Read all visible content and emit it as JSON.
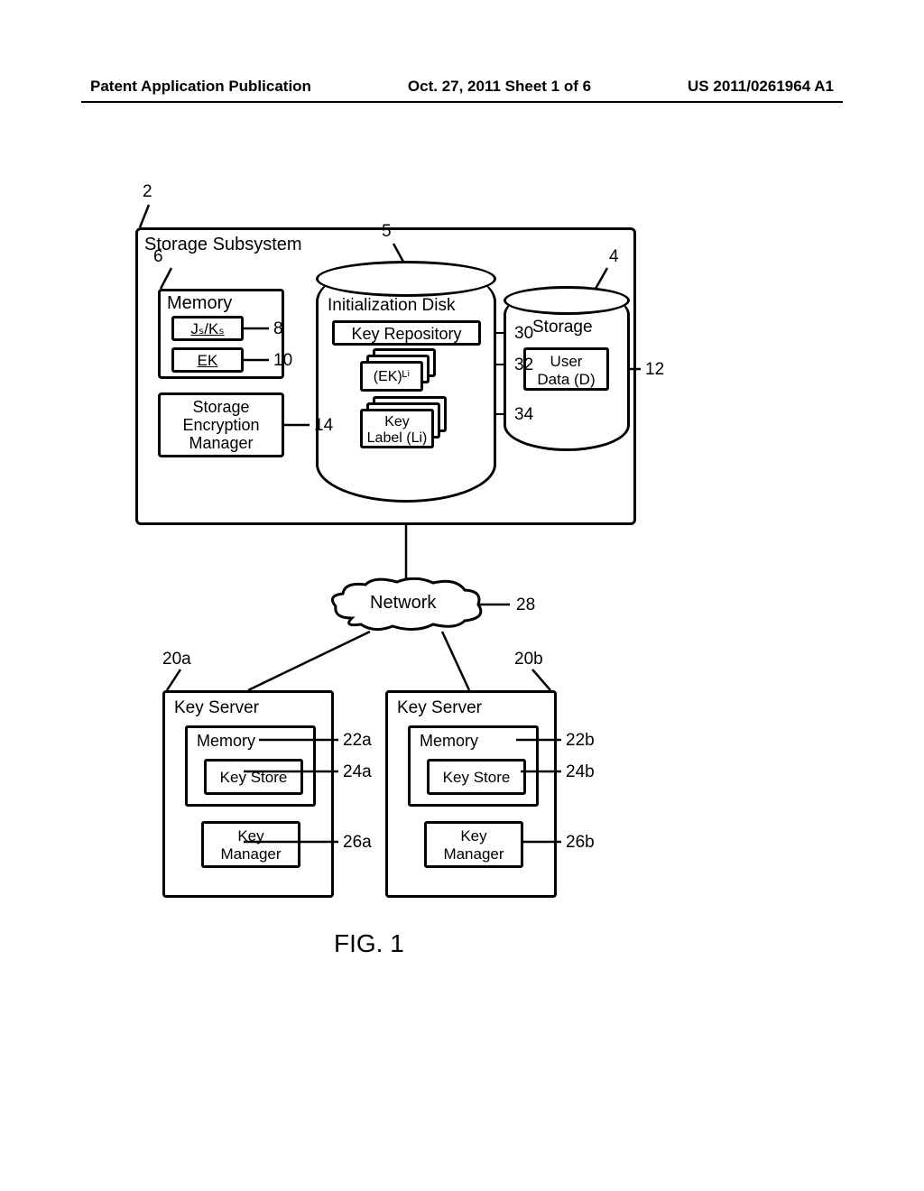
{
  "header": {
    "left": "Patent Application Publication",
    "center": "Oct. 27, 2011  Sheet 1 of 6",
    "right": "US 2011/0261964 A1"
  },
  "refs": {
    "r2": "2",
    "r4": "4",
    "r5": "5",
    "r6": "6",
    "r8": "8",
    "r10": "10",
    "r12": "12",
    "r14": "14",
    "r20a": "20a",
    "r20b": "20b",
    "r22a": "22a",
    "r22b": "22b",
    "r24a": "24a",
    "r24b": "24b",
    "r26a": "26a",
    "r26b": "26b",
    "r28": "28",
    "r30": "30",
    "r32": "32",
    "r34": "34"
  },
  "labels": {
    "storage_subsystem": "Storage Subsystem",
    "memory": "Memory",
    "jsks": "Jₛ/Kₛ",
    "ek": "EK",
    "sem": "Storage\nEncryption\nManager",
    "init_disk": "Initialization Disk",
    "key_repo": "Key Repository",
    "ek_li": "(EK)ᴸⁱ",
    "key_label": "Key\nLabel (Li)",
    "storage": "Storage",
    "user_data": "User\nData (D)",
    "network": "Network",
    "key_server": "Key Server",
    "key_store": "Key Store",
    "key_manager": "Key\nManager",
    "figure": "FIG. 1"
  }
}
